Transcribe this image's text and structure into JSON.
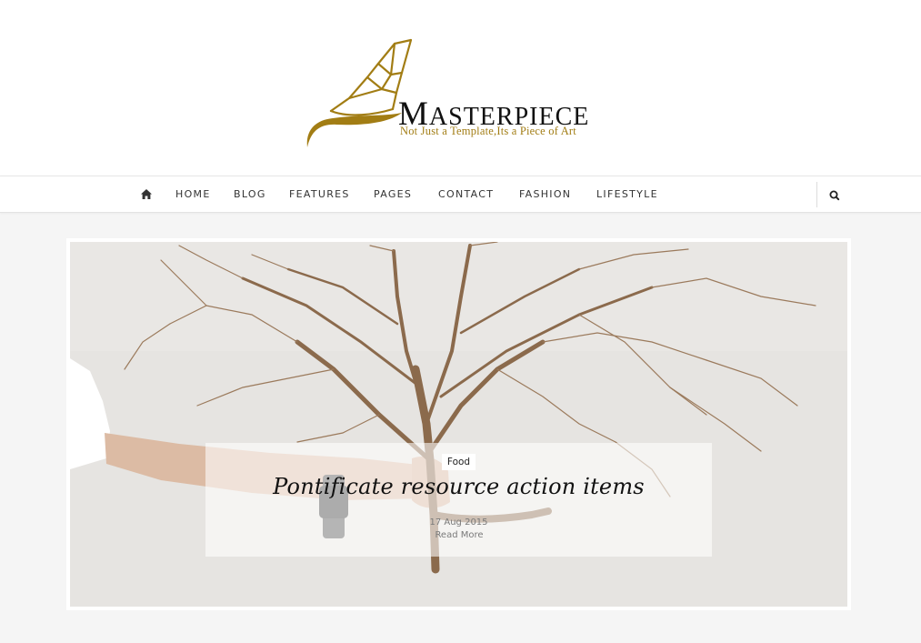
{
  "brand": {
    "title_first_letter": "M",
    "title_rest": "ASTERPIECE",
    "tagline": "Not Just a Template,Its a Piece of Art",
    "accent_color": "#a27d14"
  },
  "nav": {
    "home_icon": "home-icon",
    "items": [
      "HOME",
      "BLOG",
      "FEATURES",
      "PAGES",
      "CONTACT",
      "FASHION",
      "LIFESTYLE"
    ],
    "search_icon": "search-icon"
  },
  "featured_post": {
    "category": "Food",
    "title": "Pontificate resource action items",
    "date": "17 Aug 2015",
    "read_more": "Read More"
  }
}
